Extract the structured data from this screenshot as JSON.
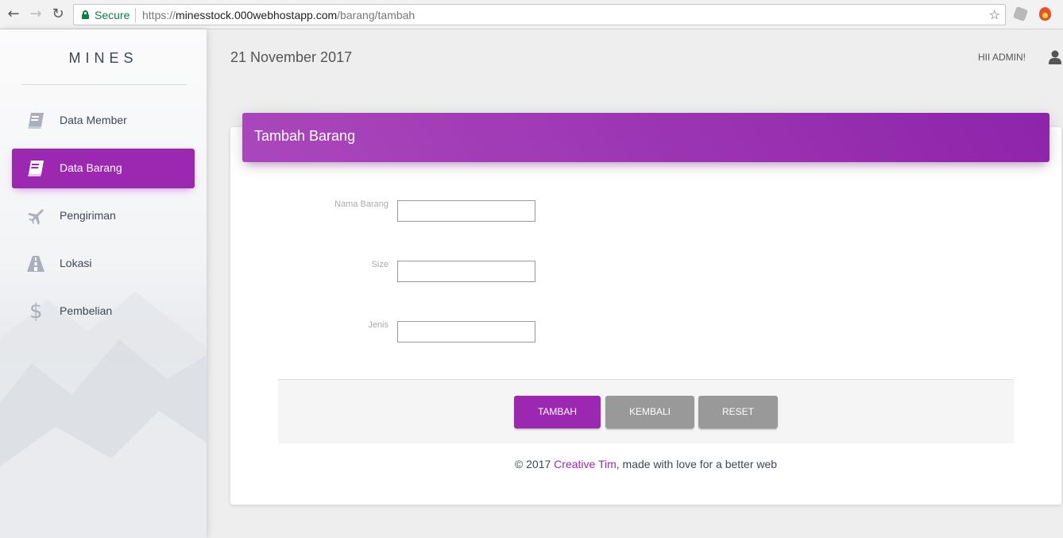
{
  "browser": {
    "secure_label": "Secure",
    "url_scheme": "https://",
    "url_host": "minesstock.000webhostapp.com",
    "url_path": "/barang/tambah"
  },
  "sidebar": {
    "brand": "MINES",
    "items": [
      {
        "label": "Data Member",
        "icon": "book-icon",
        "active": false
      },
      {
        "label": "Data Barang",
        "icon": "book-icon",
        "active": true
      },
      {
        "label": "Pengiriman",
        "icon": "airplane-icon",
        "active": false
      },
      {
        "label": "Lokasi",
        "icon": "road-icon",
        "active": false
      },
      {
        "label": "Pembelian",
        "icon": "dollar-icon",
        "active": false
      }
    ],
    "dollar_glyph": "$"
  },
  "header": {
    "date": "21 November 2017",
    "greeting": "HII ADMIN!"
  },
  "form": {
    "title": "Tambah Barang",
    "fields": [
      {
        "label": "Nama Barang",
        "value": ""
      },
      {
        "label": "Size",
        "value": ""
      },
      {
        "label": "Jenis",
        "value": ""
      }
    ],
    "buttons": {
      "submit": "TAMBAH",
      "back": "KEMBALI",
      "reset": "RESET"
    }
  },
  "footer": {
    "prefix": "© 2017 ",
    "link": "Creative Tim",
    "suffix": ", made with love for a better web"
  },
  "colors": {
    "accent": "#9c27b0",
    "button_grey": "#999999",
    "secure_green": "#0b8043"
  }
}
